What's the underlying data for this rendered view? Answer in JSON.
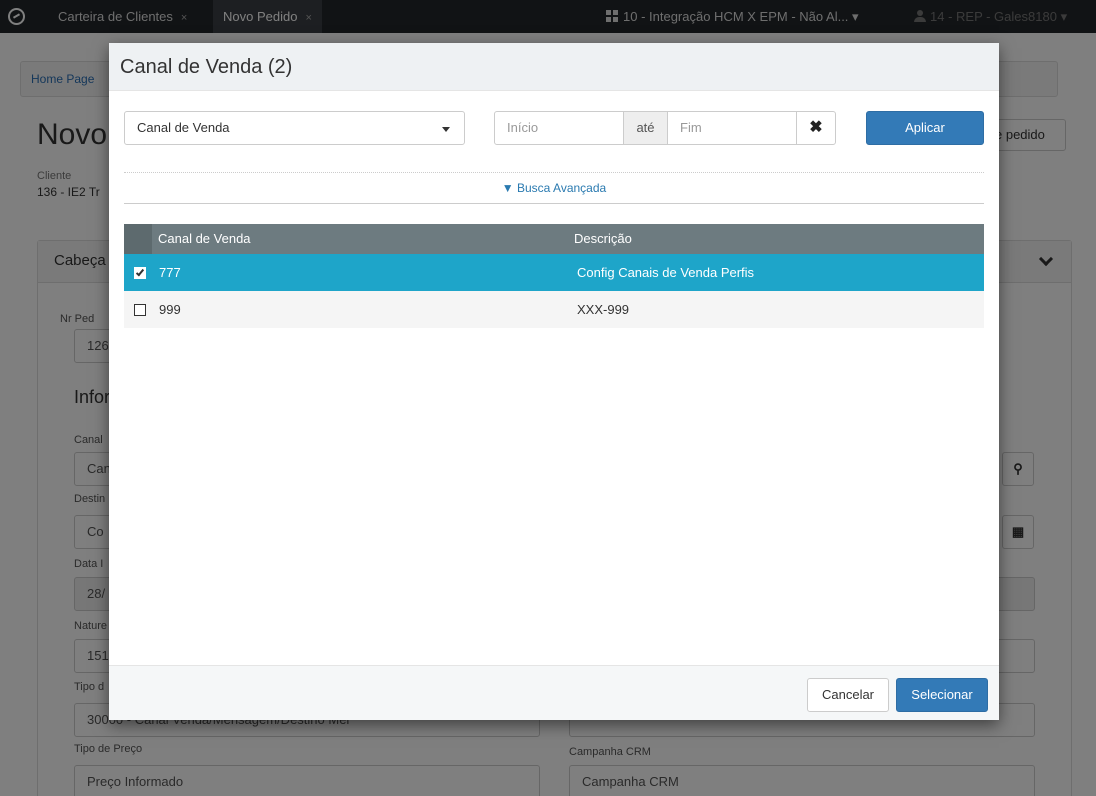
{
  "topbar": {
    "tabs": [
      {
        "label": "Carteira de Clientes",
        "close": "×"
      },
      {
        "label": "Novo Pedido",
        "close": "×"
      }
    ],
    "company": "10 - Integração HCM X EPM - Não Al...",
    "user": "14 - REP - Gales8180"
  },
  "background": {
    "breadcrumb": "Home Page",
    "title": "Novo",
    "header_button": "e pedido",
    "cliente_label": "Cliente",
    "cliente_value": "136 - IE2 Tr",
    "panel_title": "Cabeça",
    "labels": [
      "Nr Ped",
      "Infor",
      "Canal",
      "Destin",
      "Data I",
      "Nature",
      "Tipo d",
      "Tipo de Preço",
      "Campanha CRM"
    ],
    "values": [
      "126",
      "Can",
      "Co",
      "28/",
      "151",
      "30000 - Canal Venda/Mensagem/Destino Mer",
      "Preço Informado",
      "Campanha CRM"
    ]
  },
  "modal": {
    "title": "Canal de Venda (2)",
    "filter": {
      "select_value": "Canal de Venda",
      "start_placeholder": "Início",
      "range_label": "até",
      "end_placeholder": "Fim",
      "apply_label": "Aplicar"
    },
    "advanced_search": "▼ Busca Avançada",
    "table": {
      "columns": [
        "Canal de Venda",
        "Descrição"
      ],
      "rows": [
        {
          "code": "777",
          "description": "Config Canais de Venda Perfis",
          "selected": true
        },
        {
          "code": "999",
          "description": "XXX-999",
          "selected": false
        }
      ]
    },
    "footer": {
      "cancel_label": "Cancelar",
      "select_label": "Selecionar"
    }
  },
  "colors": {
    "primary": "#337ab7",
    "selected_row": "#1ea5c9",
    "table_header": "#6d7b80",
    "topbar": "#23272b"
  }
}
